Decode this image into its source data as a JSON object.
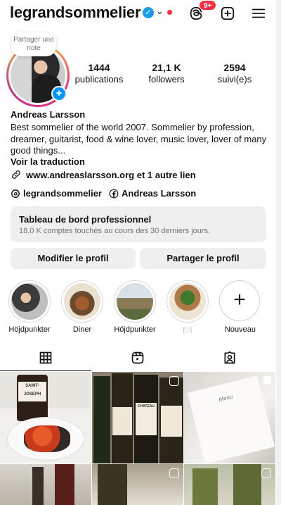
{
  "header": {
    "username": "legrandsommelier",
    "notification_badge": "9+"
  },
  "note": {
    "label": "Partager une note"
  },
  "stats": [
    {
      "value": "1444",
      "label": "publications"
    },
    {
      "value": "21,1 K",
      "label": "followers"
    },
    {
      "value": "2594",
      "label": "suivi(e)s"
    }
  ],
  "profile": {
    "name": "Andreas Larsson",
    "bio": "Best sommelier of the world 2007. Sommelier by profession, dreamer, guitarist, food & wine lover, music lover, lover of many good things...",
    "translate": "Voir la traduction",
    "link": "www.andreaslarsson.org et 1 autre lien",
    "threads": "legrandsommelier",
    "facebook": "Andreas Larsson"
  },
  "dashboard": {
    "title": "Tableau de bord professionnel",
    "subtitle": "18,0 K comptes touchés au cours des 30 derniers jours."
  },
  "buttons": {
    "edit": "Modifier le profil",
    "share": "Partager le profil"
  },
  "highlights": [
    {
      "label": "Höjdpunkter"
    },
    {
      "label": "Diner"
    },
    {
      "label": "Höjdpunkter"
    },
    {
      "label": "🍽️"
    },
    {
      "label": "Nouveau"
    }
  ],
  "grid_labels": [
    "SAINT-JOSEPH",
    "CHATEAU",
    "Menu"
  ],
  "colors": {
    "accent": "#0095f6",
    "badge": "#ff3040",
    "verified": "#1d9bf0",
    "button_bg": "#efefef"
  }
}
